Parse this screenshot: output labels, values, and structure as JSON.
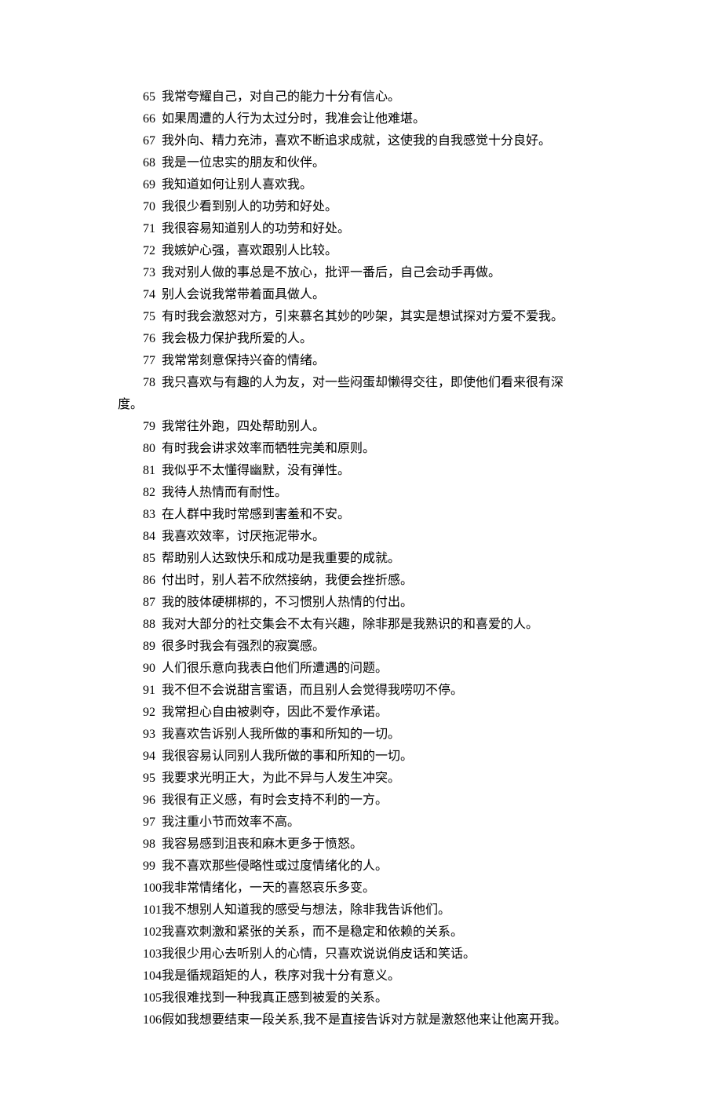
{
  "items": [
    {
      "num": "65",
      "text": "我常夸耀自己，对自己的能力十分有信心。"
    },
    {
      "num": "66",
      "text": "如果周遭的人行为太过分时，我准会让他难堪。"
    },
    {
      "num": "67",
      "text": "我外向、精力充沛，喜欢不断追求成就，这使我的自我感觉十分良好。"
    },
    {
      "num": "68",
      "text": "我是一位忠实的朋友和伙伴。"
    },
    {
      "num": "69",
      "text": "我知道如何让别人喜欢我。"
    },
    {
      "num": "70",
      "text": "我很少看到别人的功劳和好处。"
    },
    {
      "num": "71",
      "text": "我很容易知道别人的功劳和好处。"
    },
    {
      "num": "72",
      "text": "我嫉妒心强，喜欢跟别人比较。"
    },
    {
      "num": "73",
      "text": "我对别人做的事总是不放心，批评一番后，自己会动手再做。"
    },
    {
      "num": "74",
      "text": "别人会说我常带着面具做人。"
    },
    {
      "num": "75",
      "text": "有时我会激怒对方，引来慕名其妙的吵架，其实是想试探对方爱不爱我。"
    },
    {
      "num": "76",
      "text": "我会极力保护我所爱的人。"
    },
    {
      "num": "77",
      "text": "我常常刻意保持兴奋的情绪。"
    },
    {
      "num": "78",
      "text": "我只喜欢与有趣的人为友，对一些闷蛋却懒得交往，即使他们看来很有深",
      "wrap": "度。"
    },
    {
      "num": "79",
      "text": "我常往外跑，四处帮助别人。"
    },
    {
      "num": "80",
      "text": "有时我会讲求效率而牺牲完美和原则。"
    },
    {
      "num": "81",
      "text": "我似乎不太懂得幽默，没有弹性。"
    },
    {
      "num": "82",
      "text": "我待人热情而有耐性。"
    },
    {
      "num": "83",
      "text": "在人群中我时常感到害羞和不安。"
    },
    {
      "num": "84",
      "text": "我喜欢效率，讨厌拖泥带水。"
    },
    {
      "num": "85",
      "text": "帮助别人达致快乐和成功是我重要的成就。"
    },
    {
      "num": "86",
      "text": "付出时，别人若不欣然接纳，我便会挫折感。"
    },
    {
      "num": "87",
      "text": "我的肢体硬梆梆的，不习惯别人热情的付出。"
    },
    {
      "num": "88",
      "text": "我对大部分的社交集会不太有兴趣，除非那是我熟识的和喜爱的人。"
    },
    {
      "num": "89",
      "text": "很多时我会有强烈的寂寞感。"
    },
    {
      "num": "90",
      "text": "人们很乐意向我表白他们所遭遇的问题。"
    },
    {
      "num": "91",
      "text": "我不但不会说甜言蜜语，而且别人会觉得我唠叨不停。"
    },
    {
      "num": "92",
      "text": "我常担心自由被剥夺，因此不爱作承诺。"
    },
    {
      "num": "93",
      "text": "我喜欢告诉别人我所做的事和所知的一切。"
    },
    {
      "num": "94",
      "text": "我很容易认同别人我所做的事和所知的一切。"
    },
    {
      "num": "95",
      "text": "我要求光明正大，为此不异与人发生冲突。"
    },
    {
      "num": "96",
      "text": "我很有正义感，有时会支持不利的一方。"
    },
    {
      "num": "97",
      "text": "我注重小节而效率不高。"
    },
    {
      "num": "98",
      "text": "我容易感到沮丧和麻木更多于愤怒。"
    },
    {
      "num": "99",
      "text": "我不喜欢那些侵略性或过度情绪化的人。"
    },
    {
      "num": "100",
      "text": "我非常情绪化，一天的喜怒哀乐多变。"
    },
    {
      "num": "101",
      "text": "我不想别人知道我的感受与想法，除非我告诉他们。"
    },
    {
      "num": "102",
      "text": "我喜欢刺激和紧张的关系，而不是稳定和依赖的关系。"
    },
    {
      "num": "103",
      "text": "我很少用心去听别人的心情，只喜欢说说俏皮话和笑话。"
    },
    {
      "num": "104",
      "text": "我是循规蹈矩的人，秩序对我十分有意义。"
    },
    {
      "num": "105",
      "text": "我很难找到一种我真正感到被爱的关系。"
    },
    {
      "num": "106",
      "text": "假如我想要结束一段关系,我不是直接告诉对方就是激怒他来让他离开我。"
    }
  ]
}
